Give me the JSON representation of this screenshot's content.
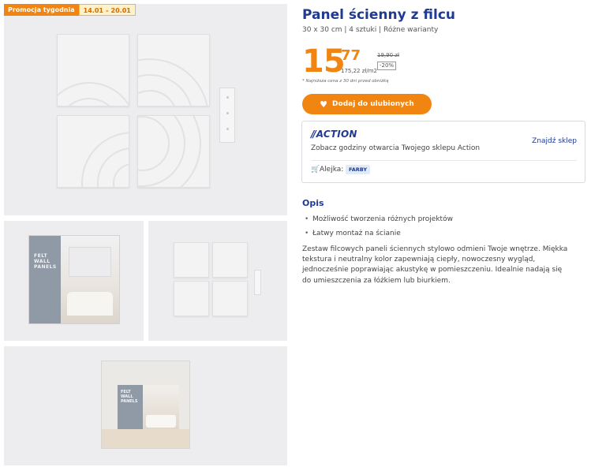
{
  "promo": {
    "label": "Promocja tygodnia",
    "dates": "14.01 – 20.01"
  },
  "product": {
    "title": "Panel ścienny z filcu",
    "subtitle": "30 x 30 cm | 4 sztuki | Różne warianty"
  },
  "price": {
    "integer": "15",
    "fraction": "77",
    "old": "19,90 zł",
    "discount": "-20%",
    "unit": "175,22 zł/m2",
    "lowest_note": "* Najniższa cena z 30 dni przed obniżką"
  },
  "favorite_button": {
    "label": "Dodaj do ulubionych",
    "icon": "heart-icon"
  },
  "store": {
    "logo": "ACTION",
    "text": "Zobacz godziny otwarcia Twojego sklepu Action",
    "link": "Znajdź sklep",
    "aisle_label": "Alejka:",
    "aisle_value": "FARBY"
  },
  "description": {
    "title": "Opis",
    "bullets": [
      "Możliwość tworzenia różnych projektów",
      "Łatwy montaż na ścianie"
    ],
    "body": "Zestaw filcowych paneli ściennych stylowo odmieni Twoje wnętrze. Miękka tekstura i neutralny kolor zapewniają ciepły, nowoczesny wygląd, jednocześnie poprawiając akustykę w pomieszczeniu. Idealnie nadają się do umieszczenia za łóżkiem lub biurkiem."
  },
  "gallery": {
    "pack_text": "FELT WALL PANELS",
    "room_pack_text": "FELT WALL PANELS"
  },
  "colors": {
    "brand_orange": "#f08512",
    "brand_blue": "#1f3a93"
  }
}
